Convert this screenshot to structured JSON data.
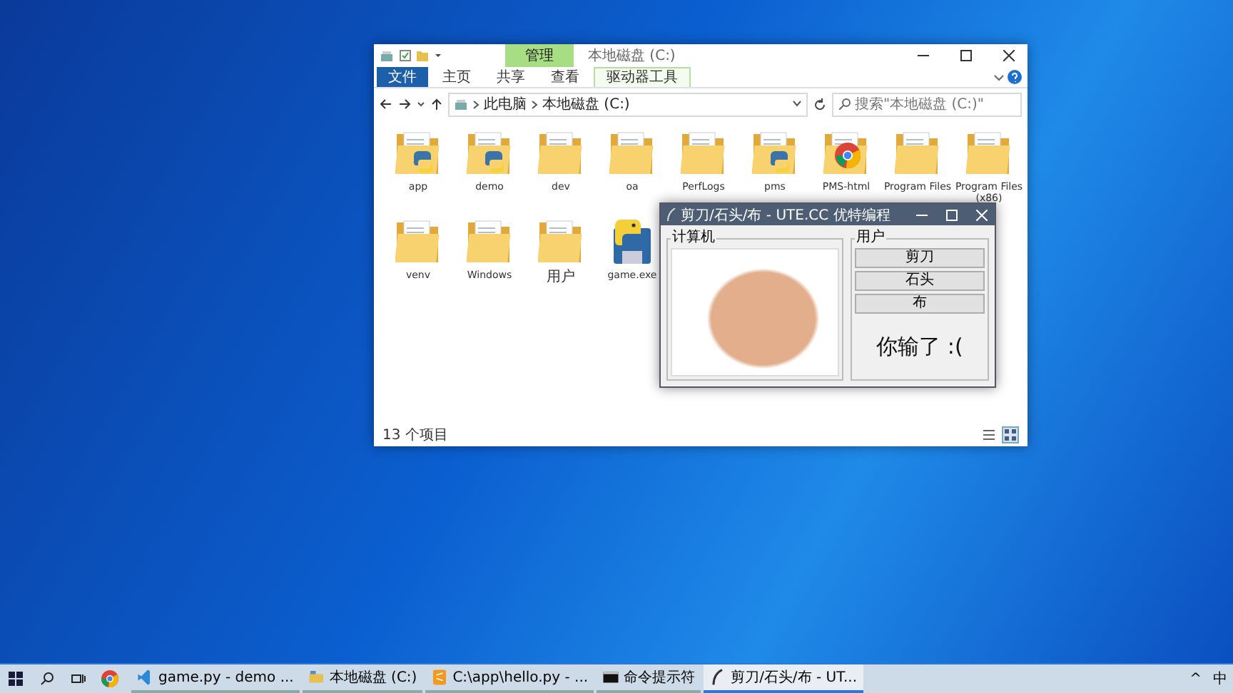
{
  "explorer": {
    "title": "本地磁盘 (C:)",
    "context_tab": "管理",
    "ribbon_tabs": [
      {
        "label": "文件",
        "kind": "file"
      },
      {
        "label": "主页",
        "kind": "tab"
      },
      {
        "label": "共享",
        "kind": "tab"
      },
      {
        "label": "查看",
        "kind": "tab"
      },
      {
        "label": "驱动器工具",
        "kind": "context"
      }
    ],
    "breadcrumb": [
      "此电脑",
      "本地磁盘 (C:)"
    ],
    "search": {
      "placeholder": "搜索\"本地磁盘 (C:)\""
    },
    "items": [
      {
        "name": "app",
        "kind": "folder-python"
      },
      {
        "name": "demo",
        "kind": "folder-python"
      },
      {
        "name": "dev",
        "kind": "folder"
      },
      {
        "name": "oa",
        "kind": "folder"
      },
      {
        "name": "PerfLogs",
        "kind": "folder"
      },
      {
        "name": "pms",
        "kind": "folder-python"
      },
      {
        "name": "PMS-html",
        "kind": "folder-chrome"
      },
      {
        "name": "Program Files",
        "kind": "folder"
      },
      {
        "name": "Program Files (x86)",
        "kind": "folder"
      },
      {
        "name": "venv",
        "kind": "folder"
      },
      {
        "name": "Windows",
        "kind": "folder"
      },
      {
        "name": "用户",
        "kind": "folder"
      },
      {
        "name": "game.exe",
        "kind": "python-exe"
      }
    ],
    "status": "13 个项目",
    "views": [
      {
        "kind": "details",
        "selected": false
      },
      {
        "kind": "large-icons",
        "selected": true
      }
    ]
  },
  "game": {
    "title": "剪刀/石头/布 - UTE.CC 优特编程",
    "computer": {
      "label": "计算机"
    },
    "user": {
      "label": "用户",
      "buttons": [
        "剪刀",
        "石头",
        "布"
      ],
      "result": "你输了 :("
    }
  },
  "taskbar": {
    "apps": [
      {
        "label": "game.py - demo ...",
        "kind": "vscode",
        "selected": false
      },
      {
        "label": "本地磁盘 (C:)",
        "kind": "explorer",
        "selected": false
      },
      {
        "label": "C:\\app\\hello.py - ...",
        "kind": "sublime",
        "selected": false
      },
      {
        "label": "命令提示符",
        "kind": "cmd",
        "selected": false
      },
      {
        "label": "剪刀/石头/布 - UT...",
        "kind": "feather",
        "selected": true
      }
    ],
    "tray": [
      "^",
      "中"
    ]
  }
}
